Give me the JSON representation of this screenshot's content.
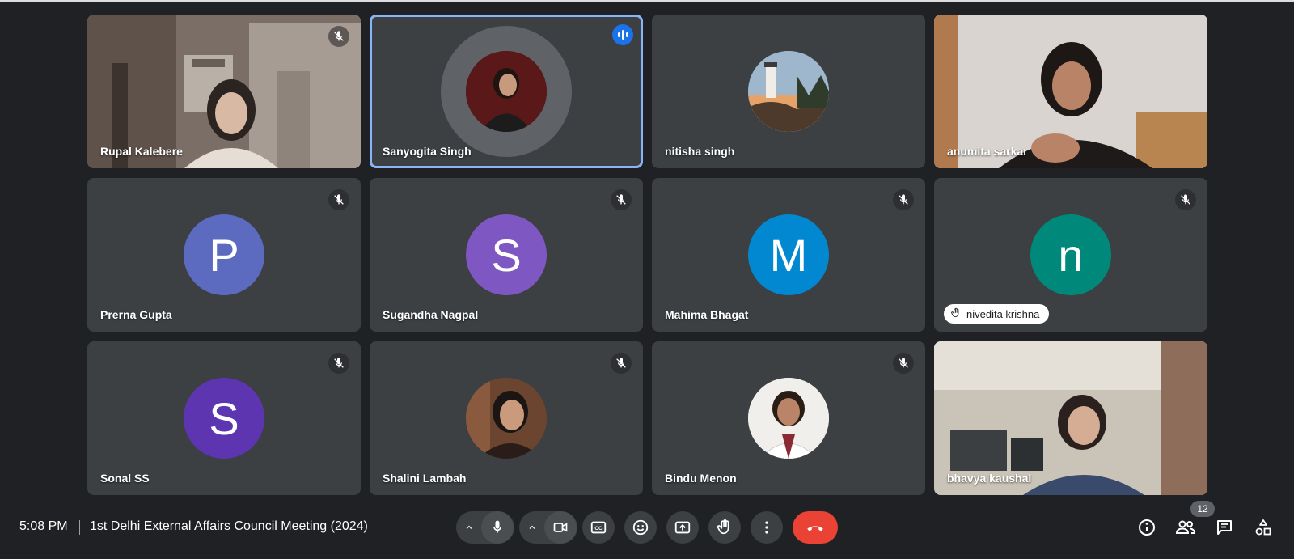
{
  "participants": [
    {
      "name": "Rupal Kalebere",
      "muted": true
    },
    {
      "name": "Sanyogita Singh",
      "muted": false,
      "speaking": true
    },
    {
      "name": "nitisha singh",
      "muted": false
    },
    {
      "name": "anumita sarkar",
      "muted": false
    },
    {
      "name": "Prerna Gupta",
      "muted": true,
      "initial": "P",
      "color": "#5c6bc0"
    },
    {
      "name": "Sugandha Nagpal",
      "muted": true,
      "initial": "S",
      "color": "#7e57c2"
    },
    {
      "name": "Mahima Bhagat",
      "muted": true,
      "initial": "M",
      "color": "#0288d1"
    },
    {
      "name": "nivedita krishna",
      "muted": true,
      "initial": "n",
      "color": "#00897b",
      "hand_raised": true
    },
    {
      "name": "Sonal SS",
      "muted": true,
      "initial": "S",
      "color": "#5e35b1"
    },
    {
      "name": "Shalini Lambah",
      "muted": true
    },
    {
      "name": "Bindu Menon",
      "muted": true
    },
    {
      "name": "bhavya kaushal",
      "muted": false
    }
  ],
  "bottom_bar": {
    "time": "5:08 PM",
    "meeting_title": "1st Delhi External Affairs Council Meeting (2024)",
    "people_count": "12"
  },
  "colors": {
    "background": "#202124",
    "tile": "#3c4043",
    "speaking_outline": "#8ab4f8",
    "end_call": "#ea4335",
    "speaking_badge": "#1a73e8"
  },
  "icons": [
    "mic-off-icon",
    "audio-level-icon",
    "raise-hand-icon",
    "chevron-up-icon",
    "mic-icon",
    "camera-icon",
    "closed-captions-icon",
    "emoji-icon",
    "present-screen-icon",
    "hand-icon",
    "more-vert-icon",
    "end-call-icon",
    "info-icon",
    "people-icon",
    "chat-icon",
    "activities-icon"
  ]
}
